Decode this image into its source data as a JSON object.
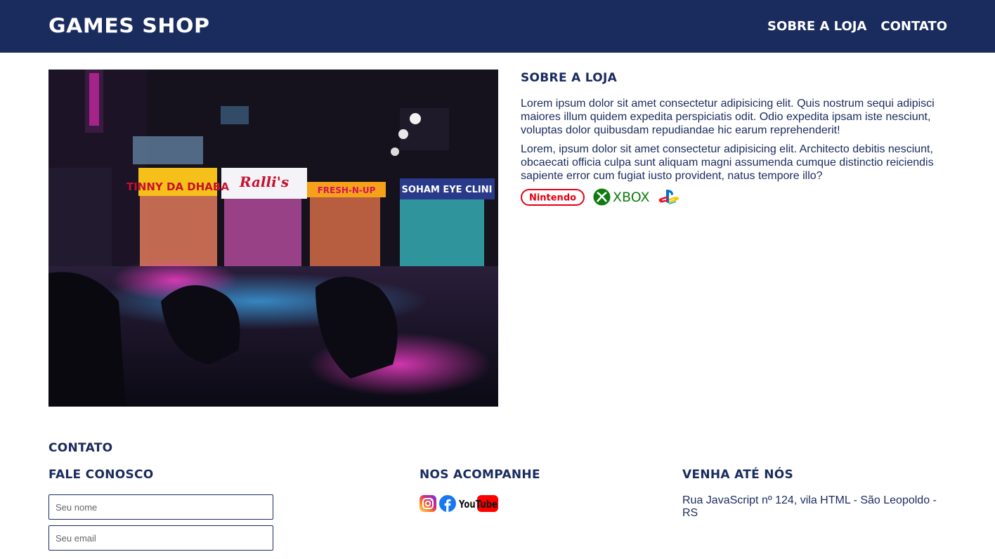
{
  "header": {
    "brand": "GAMES SHOP",
    "nav": [
      "SOBRE A LOJA",
      "CONTATO"
    ]
  },
  "about": {
    "title": "SOBRE A LOJA",
    "paragraphs": [
      "Lorem ipsum dolor sit amet consectetur adipisicing elit. Quis nostrum sequi adipisci maiores illum quidem expedita perspiciatis odit. Odio expedita ipsam iste nesciunt, voluptas dolor quibusdam repudiandae hic earum reprehenderit!",
      "Lorem, ipsum dolor sit amet consectetur adipisicing elit. Architecto debitis nesciunt, obcaecati officia culpa sunt aliquam magni assumenda cumque distinctio reiciendis sapiente error cum fugiat iusto provident, natus tempore illo?"
    ],
    "brands": [
      "Nintendo",
      "XBOX",
      "PlayStation"
    ],
    "image_signs": [
      "TINNY DA DHABA",
      "Ralli's",
      "FRESH-N-UP",
      "SOHAM EYE CLINI"
    ]
  },
  "contact": {
    "title": "CONTATO",
    "form": {
      "title": "FALE CONOSCO",
      "name_placeholder": "Seu nome",
      "email_placeholder": "Seu email"
    },
    "social": {
      "title": "NOS ACOMPANHE",
      "icons": [
        "instagram-icon",
        "facebook-icon",
        "youtube-icon"
      ],
      "youtube_label": "YouTube"
    },
    "address": {
      "title": "VENHA ATÉ NÓS",
      "text": "Rua JavaScript nº 124, vila HTML - São Leopoldo - RS"
    }
  },
  "colors": {
    "primary": "#1a2b5e",
    "nintendo": "#e60012",
    "xbox": "#107c10",
    "facebook": "#1877f2",
    "youtube": "#ff0000"
  }
}
